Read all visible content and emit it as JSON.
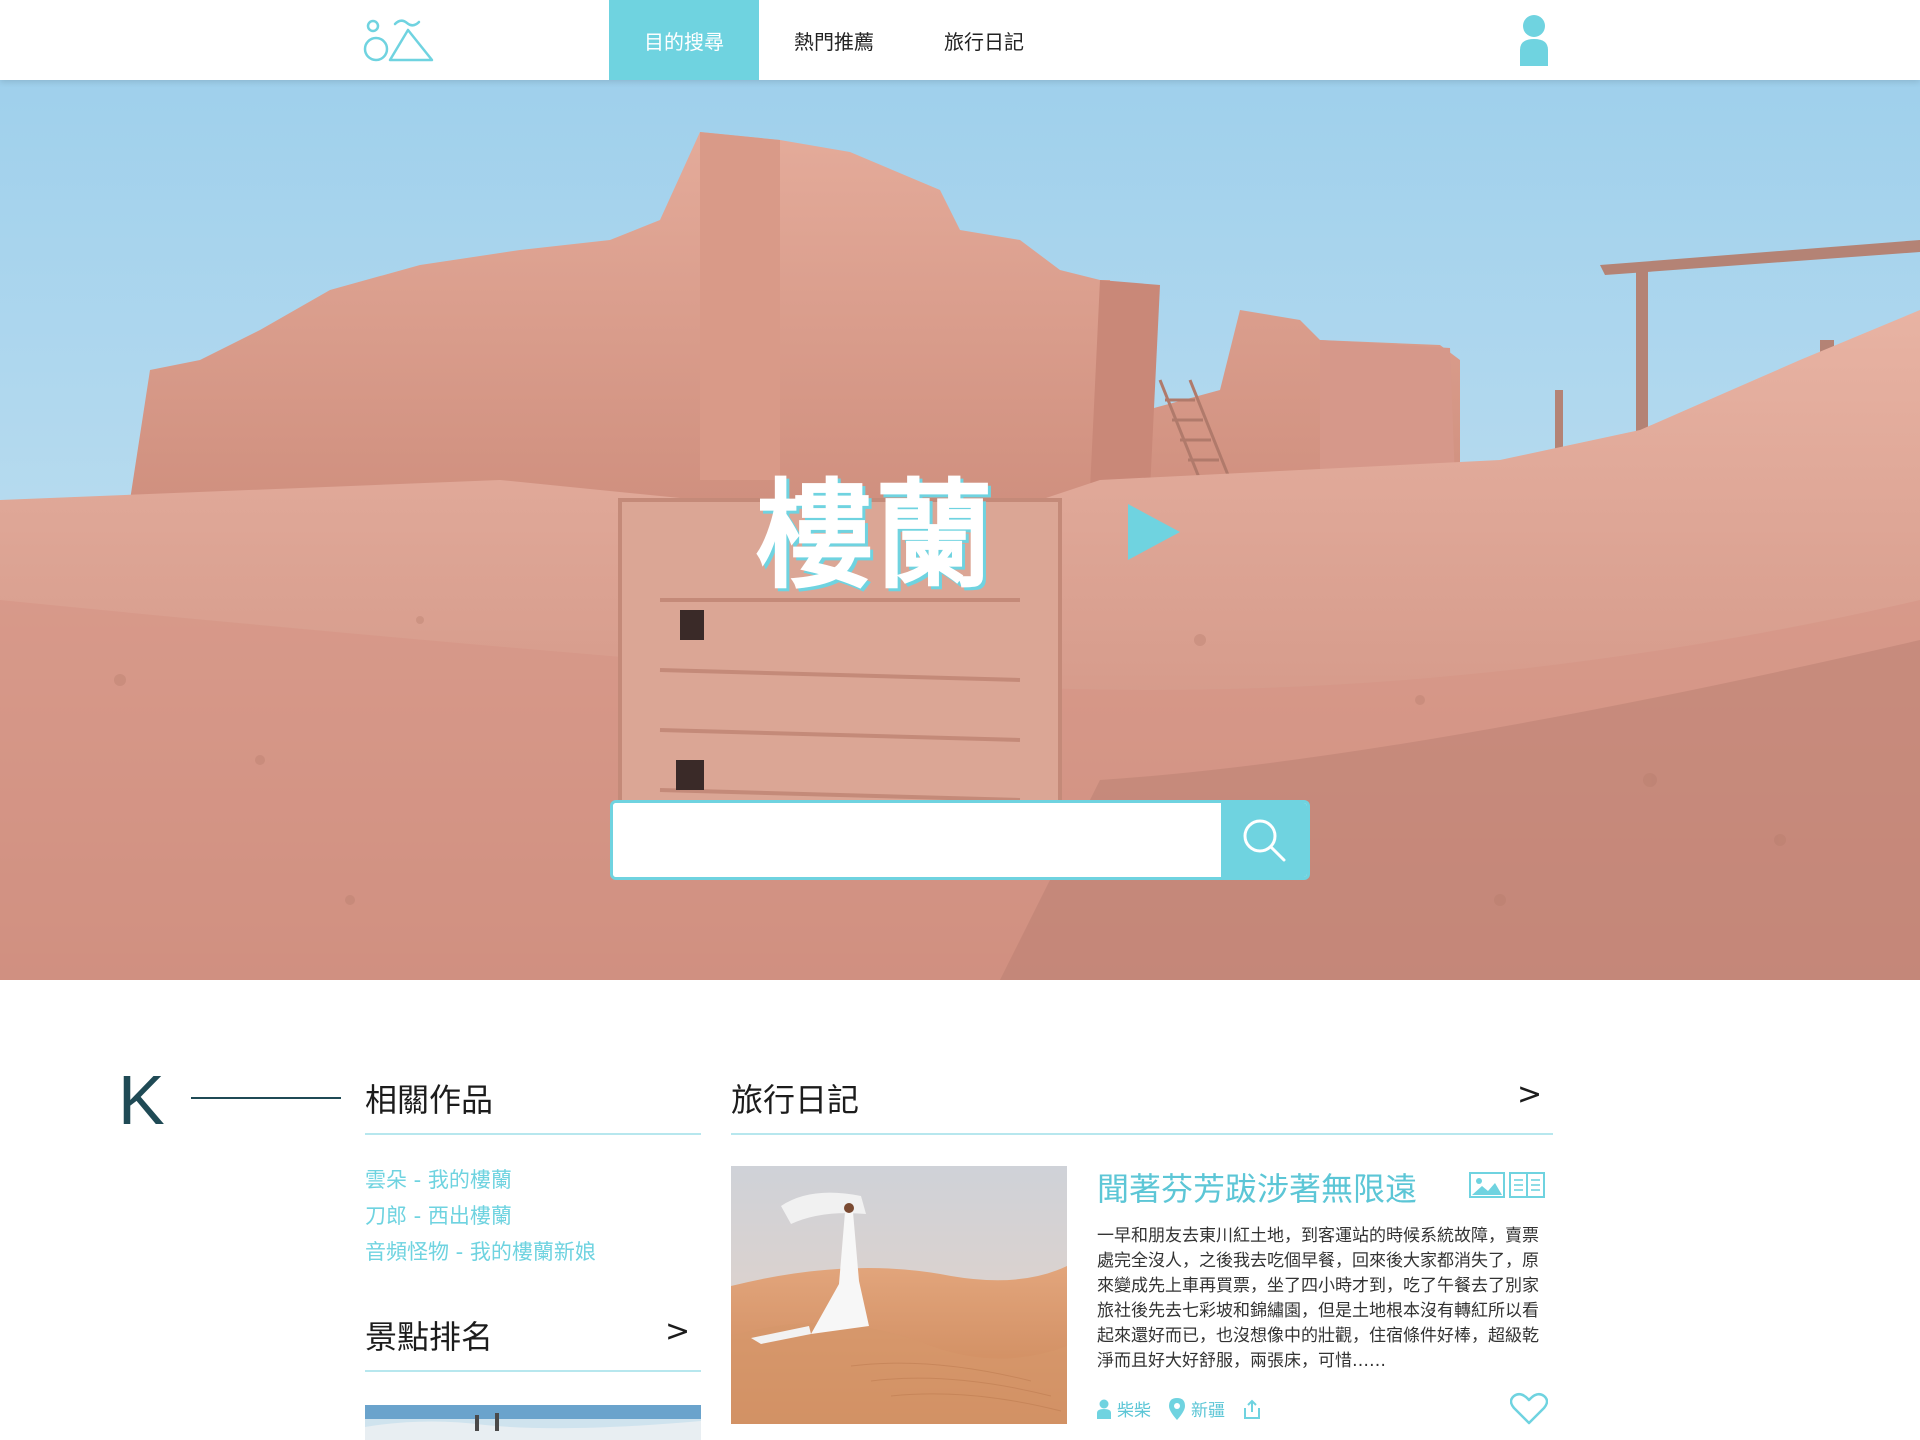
{
  "colors": {
    "accent": "#6fd3e0",
    "accent_dark": "#5cc6d6",
    "dark_teal": "#1f4a55"
  },
  "header": {
    "tabs": [
      {
        "label": "目的搜尋",
        "active": true
      },
      {
        "label": "熱門推薦",
        "active": false
      },
      {
        "label": "旅行日記",
        "active": false
      }
    ],
    "logo_icon": "logo-icon",
    "user_icon": "user-icon"
  },
  "hero": {
    "title": "樓蘭",
    "search": {
      "value": "",
      "placeholder": ""
    }
  },
  "side_mark": {
    "letter": "K"
  },
  "works": {
    "title": "相關作品",
    "items": [
      "雲朵 - 我的樓蘭",
      "刀郎 - 西出樓蘭",
      "音頻怪物 - 我的樓蘭新娘"
    ]
  },
  "ranking": {
    "title": "景點排名",
    "more": ">"
  },
  "diary": {
    "section_title": "旅行日記",
    "more": ">",
    "post": {
      "title": "聞著芬芳跋涉著無限遠",
      "body": "一早和朋友去東川紅土地，到客運站的時候系統故障，賣票處完全沒人，之後我去吃個早餐，回來後大家都消失了，原來變成先上車再買票，坐了四小時才到，吃了午餐去了別家旅社後先去七彩坡和錦繡園，但是土地根本沒有轉紅所以看起來還好而已，也沒想像中的壯觀，住宿條件好棒，超級乾淨而且好大好舒服，兩張床，可惜……",
      "author": "柴柴",
      "location": "新疆"
    }
  }
}
